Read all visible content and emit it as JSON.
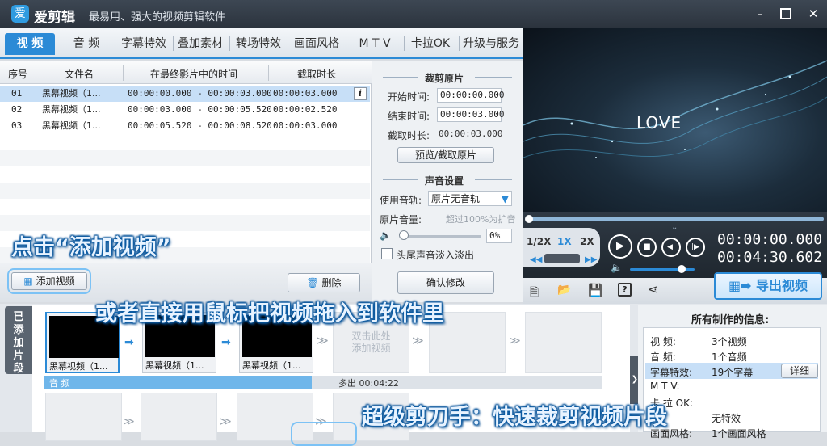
{
  "app": {
    "name": "爱剪辑",
    "slogan": "最易用、强大的视频剪辑软件",
    "logo_glyph": "爱",
    "window_controls": [
      "minimize",
      "maximize",
      "close"
    ]
  },
  "tabs": [
    "视 频",
    "音 频",
    "字幕特效",
    "叠加素材",
    "转场特效",
    "画面风格",
    "M T V",
    "卡拉OK",
    "升级与服务"
  ],
  "active_tab": "视 频",
  "clip_table": {
    "headers": [
      "序号",
      "文件名",
      "在最终影片中的时间",
      "截取时长"
    ],
    "rows": [
      {
        "index": "01",
        "name": "黑幕视频（1...",
        "time": "00:00:00.000 - 00:00:03.000",
        "duration": "00:00:03.000"
      },
      {
        "index": "02",
        "name": "黑幕视频（1...",
        "time": "00:00:03.000 - 00:00:05.520",
        "duration": "00:00:02.520"
      },
      {
        "index": "03",
        "name": "黑幕视频（1...",
        "time": "00:00:05.520 - 00:00:08.520",
        "duration": "00:00:03.000"
      }
    ],
    "info_glyph": "i"
  },
  "list_buttons": {
    "add_video": "添加视频",
    "delete": "删除"
  },
  "trim": {
    "title": "裁剪原片",
    "start_label": "开始时间:",
    "start_value": "00:00:00.000",
    "end_label": "结束时间:",
    "end_value": "00:00:03.000",
    "duration_label": "截取时长:",
    "duration_value": "00:00:03.000",
    "preview_button": "预览/截取原片"
  },
  "sound": {
    "title": "声音设置",
    "track_label": "使用音轨:",
    "track_value": "原片无音轨",
    "volume_label": "原片音量:",
    "volume_hint": "超过100%为扩音",
    "volume_value": "0%",
    "volume_level": 0,
    "fade_label": "头尾声音淡入淡出",
    "fade_checked": false,
    "confirm_button": "确认修改"
  },
  "preview": {
    "overlay_text": "LOVE",
    "progress": 0
  },
  "player": {
    "speeds": [
      "1/2X",
      "1X",
      "2X"
    ],
    "active_speed": "1X",
    "current_time": "00:00:00.000",
    "total_time": "00:04:30.602",
    "volume_level": 0.8,
    "export_button": "导出视频"
  },
  "timeline": {
    "side_label": "已添加片段",
    "clips": [
      "黑幕视频（1...",
      "黑幕视频（1...",
      "黑幕视频（1..."
    ],
    "empty_slot_text": "双击此处\n添加视频",
    "audio_label": "音 频",
    "audio_overflow": "多出 00:04:22",
    "audio_fill_fraction": 0.48
  },
  "info": {
    "title": "所有制作的信息:",
    "rows": [
      {
        "key": "视 频:",
        "value": "3个视频"
      },
      {
        "key": "音 频:",
        "value": "1个音频"
      },
      {
        "key": "字幕特效:",
        "value": "19个字幕",
        "button": "详细"
      },
      {
        "key": "M T V:",
        "value": ""
      },
      {
        "key": "卡 拉 OK:",
        "value": ""
      },
      {
        "key": "",
        "value": "无特效"
      },
      {
        "key": "画面风格:",
        "value": "1个画面风格"
      }
    ]
  },
  "annotations": {
    "click_add": "点击“添加视频”",
    "drag_hint": "或者直接用鼠标把视频拖入到软件里",
    "trim_hint": "超级剪刀手：快速裁剪视频片段"
  },
  "colors": {
    "accent": "#2b8ad6",
    "titlebar": "#2b333d",
    "selection": "#c7dff7"
  }
}
